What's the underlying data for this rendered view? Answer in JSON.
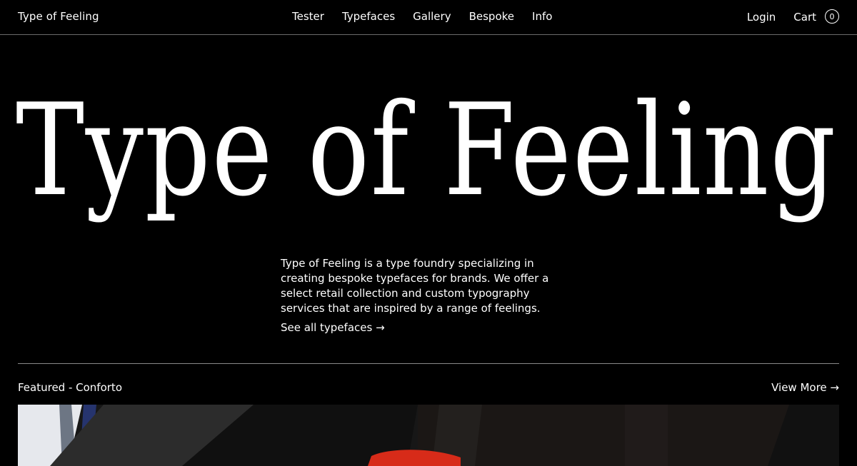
{
  "header": {
    "brand": "Type of Feeling",
    "nav": [
      "Tester",
      "Typefaces",
      "Gallery",
      "Bespoke",
      "Info"
    ],
    "login": "Login",
    "cart_label": "Cart",
    "cart_count": "0"
  },
  "hero": {
    "wordmark": "Type of Feeling",
    "description": "Type of Feeling is a type foundry specializing in creating bespoke typefaces for brands. We offer a select retail collection and custom typography services that are inspired by a range of feelings.",
    "link_label": "See all typefaces →"
  },
  "featured": {
    "label": "Featured - Conforto",
    "view_more": "View More →"
  },
  "colors": {
    "background": "#000000",
    "text": "#ffffff",
    "divider": "#8a8a8a"
  },
  "icons": [
    "arrow-right-icon",
    "cart-count-badge"
  ]
}
